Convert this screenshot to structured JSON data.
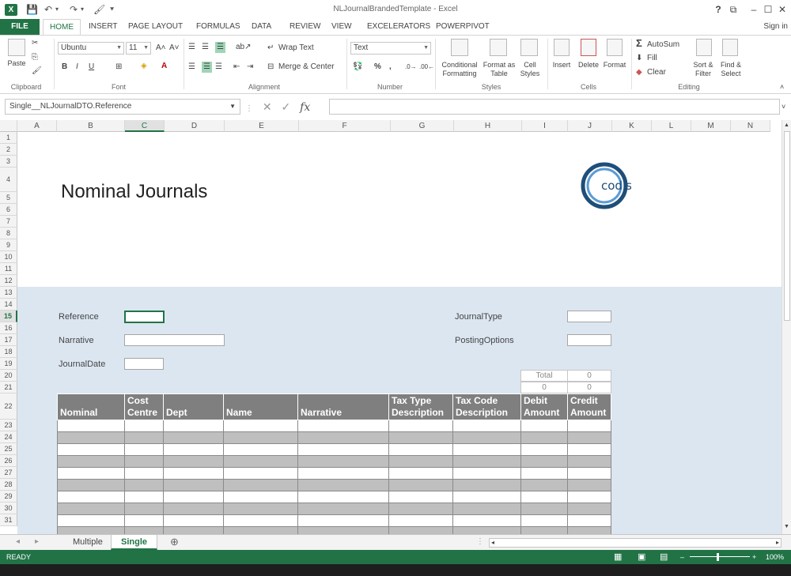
{
  "window": {
    "title": "NLJournalBrandedTemplate - Excel",
    "help": "?",
    "controls": [
      "⧉",
      "–",
      "☐",
      "✕"
    ]
  },
  "ribbon": {
    "file_tab": "FILE",
    "tabs": [
      "HOME",
      "INSERT",
      "PAGE LAYOUT",
      "FORMULAS",
      "DATA",
      "REVIEW",
      "VIEW",
      "EXCELERATORS",
      "POWERPIVOT"
    ],
    "active_tab": "HOME",
    "signin": "Sign in",
    "groups": [
      "Clipboard",
      "Font",
      "Alignment",
      "Number",
      "Styles",
      "Cells",
      "Editing"
    ],
    "clipboard": {
      "paste": "Paste"
    },
    "font": {
      "name": "Ubuntu",
      "size": "11",
      "bold": "B",
      "italic": "I",
      "underline": "U"
    },
    "alignment": {
      "wrap_text": "Wrap Text",
      "merge_center": "Merge & Center"
    },
    "number": {
      "format": "Text",
      "percent": "%",
      "comma": ","
    },
    "styles": {
      "conditional": "Conditional",
      "conditional2": "Formatting",
      "format_table": "Format as",
      "format_table2": "Table",
      "cell_styles": "Cell",
      "cell_styles2": "Styles"
    },
    "cells": {
      "insert": "Insert",
      "delete": "Delete",
      "format": "Format"
    },
    "editing": {
      "autosum": "AutoSum",
      "fill": "Fill",
      "clear": "Clear",
      "sort": "Sort &",
      "sort2": "Filter",
      "find": "Find &",
      "find2": "Select"
    }
  },
  "formula_bar": {
    "name_box": "Single__NLJournalDTO.Reference",
    "formula": ""
  },
  "columns": [
    "A",
    "B",
    "C",
    "D",
    "E",
    "F",
    "G",
    "H",
    "I",
    "J",
    "K",
    "L",
    "M",
    "N"
  ],
  "selected_column": "C",
  "rows": [
    "1",
    "2",
    "3",
    "4",
    "5",
    "6",
    "7",
    "8",
    "9",
    "10",
    "11",
    "12",
    "13",
    "14",
    "15",
    "16",
    "17",
    "18",
    "19",
    "20",
    "21",
    "22",
    "23",
    "24",
    "25",
    "26",
    "27",
    "28",
    "29",
    "30",
    "31"
  ],
  "selected_row": "15",
  "sheet": {
    "title": "Nominal Journals",
    "logo_text": "codis",
    "fields": {
      "reference": "Reference",
      "narrative": "Narrative",
      "journal_date": "JournalDate",
      "journal_type": "JournalType",
      "posting_options": "PostingOptions"
    },
    "totals": {
      "label": "Total",
      "total_value": "0",
      "debit_total": "0",
      "credit_total": "0"
    },
    "table_headers": [
      [
        "Nominal"
      ],
      [
        "Cost",
        "Centre"
      ],
      [
        "Dept"
      ],
      [
        "Name"
      ],
      [
        "Narrative"
      ],
      [
        "Tax Type",
        "Description"
      ],
      [
        "Tax Code",
        "Description"
      ],
      [
        "Debit",
        "Amount"
      ],
      [
        "Credit",
        "Amount"
      ]
    ]
  },
  "sheet_tabs": [
    "Multiple",
    "Single"
  ],
  "active_sheet": "Single",
  "status": {
    "ready": "READY",
    "zoom": "100%"
  }
}
